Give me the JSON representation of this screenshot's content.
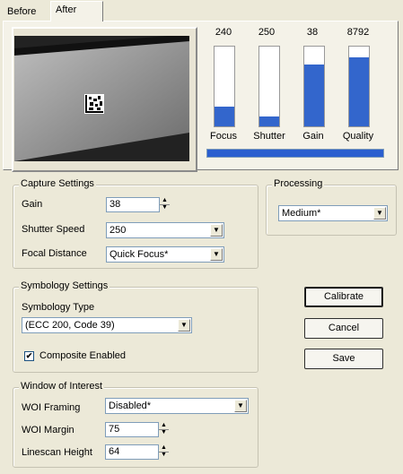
{
  "tabs": [
    {
      "label": "Before"
    },
    {
      "label": "After"
    }
  ],
  "meters": [
    {
      "value": "240",
      "label": "Focus",
      "fill": 0.25
    },
    {
      "value": "250",
      "label": "Shutter",
      "fill": 0.12
    },
    {
      "value": "38",
      "label": "Gain",
      "fill": 0.78
    },
    {
      "value": "8792",
      "label": "Quality",
      "fill": 0.87
    }
  ],
  "capture": {
    "title": "Capture Settings",
    "gain_label": "Gain",
    "gain_value": "38",
    "shutter_label": "Shutter Speed",
    "shutter_value": "250",
    "focal_label": "Focal Distance",
    "focal_value": "Quick Focus*"
  },
  "processing": {
    "title": "Processing",
    "value": "Medium*"
  },
  "symbology": {
    "title": "Symbology Settings",
    "type_label": "Symbology Type",
    "type_value": "(ECC 200, Code 39)",
    "composite_label": "Composite Enabled",
    "composite_checked": true
  },
  "woi": {
    "title": "Window of Interest",
    "framing_label": "WOI Framing",
    "framing_value": "Disabled*",
    "margin_label": "WOI Margin",
    "margin_value": "75",
    "linescan_label": "Linescan Height",
    "linescan_value": "64"
  },
  "buttons": {
    "calibrate": "Calibrate",
    "cancel": "Cancel",
    "save": "Save"
  },
  "icons": {
    "spin_up": "▲",
    "spin_down": "▼",
    "dropdown": "▼",
    "check": "✔"
  }
}
